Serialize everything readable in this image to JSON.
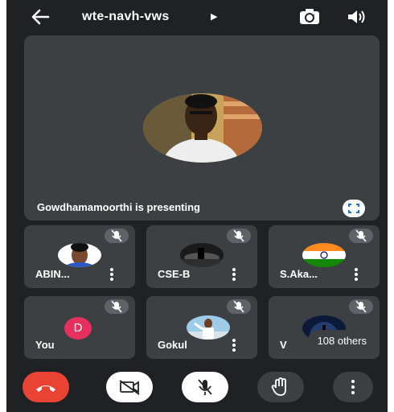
{
  "meeting": {
    "code": "wte-navh-vws"
  },
  "presenter": {
    "status_text": "Gowdhamamoorthi is presenting"
  },
  "participants": [
    {
      "name": "ABIN..."
    },
    {
      "name": "CSE-B"
    },
    {
      "name": "S.Aka..."
    },
    {
      "name": "You",
      "initial": "D"
    },
    {
      "name": "Gokul"
    },
    {
      "name": "V"
    }
  ],
  "others_label": "108 others",
  "colors": {
    "background": "#202124",
    "tile": "#3c4043",
    "end_call": "#ea4335",
    "self_avatar": "#e8305f"
  }
}
